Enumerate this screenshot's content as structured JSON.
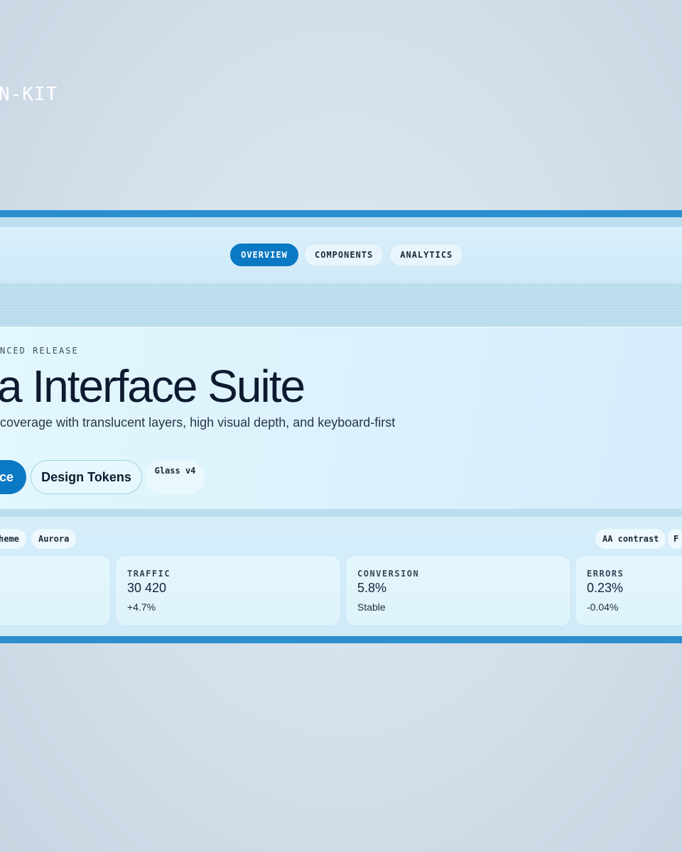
{
  "brand": {
    "kit_label": "N-KIT"
  },
  "nav": {
    "tabs": [
      {
        "label": "OVERVIEW",
        "active": true
      },
      {
        "label": "COMPONENTS",
        "active": false
      },
      {
        "label": "ANALYTICS",
        "active": false
      }
    ]
  },
  "hero": {
    "eyebrow": "NCED RELEASE",
    "title": "a Interface Suite",
    "subtitle": "coverage with translucent layers, high visual depth, and keyboard-first",
    "primary_button": "ce",
    "secondary_button": "Design Tokens",
    "version": "Glass v4"
  },
  "chips": {
    "theme": "heme",
    "aurora": "Aurora",
    "contrast": "AA contrast",
    "f": "F"
  },
  "metrics": [
    {
      "label": "",
      "value": "",
      "delta": ""
    },
    {
      "label": "TRAFFIC",
      "value": "30 420",
      "delta": "+4.7%"
    },
    {
      "label": "CONVERSION",
      "value": "5.8%",
      "delta": "Stable"
    },
    {
      "label": "ERRORS",
      "value": "0.23%",
      "delta": "-0.04%"
    }
  ],
  "colors": {
    "accent": "#0a78c2",
    "frame_bar": "#2a8fcc",
    "background": "#d3dfea"
  }
}
